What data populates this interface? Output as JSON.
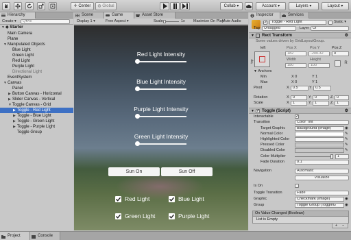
{
  "toolbar": {
    "pivot": "Center",
    "space": "Global",
    "collab": "Collab ▾",
    "account": "Account",
    "layers": "Layers",
    "layout": "Layout"
  },
  "hierarchy": {
    "tab": "Hierarchy",
    "create": "Create ▾",
    "search_placeholder": "Q▾All",
    "scene": "Starter",
    "items": [
      {
        "label": "Main Camera",
        "depth": 1,
        "tri": "",
        "state": ""
      },
      {
        "label": "Plane",
        "depth": 1,
        "tri": "",
        "state": ""
      },
      {
        "label": "Manipulated Objects",
        "depth": 1,
        "tri": "▼",
        "state": ""
      },
      {
        "label": "Blue Light",
        "depth": 2,
        "tri": "",
        "state": ""
      },
      {
        "label": "Green Light",
        "depth": 2,
        "tri": "",
        "state": ""
      },
      {
        "label": "Red Light",
        "depth": 2,
        "tri": "",
        "state": ""
      },
      {
        "label": "Purple Light",
        "depth": 2,
        "tri": "",
        "state": ""
      },
      {
        "label": "Directional Light",
        "depth": 2,
        "tri": "",
        "state": "dim"
      },
      {
        "label": "EventSystem",
        "depth": 1,
        "tri": "",
        "state": ""
      },
      {
        "label": "Canvas",
        "depth": 1,
        "tri": "▼",
        "state": ""
      },
      {
        "label": "Panel",
        "depth": 2,
        "tri": "",
        "state": ""
      },
      {
        "label": "Button Canvas - Horizontal",
        "depth": 2,
        "tri": "▶",
        "state": ""
      },
      {
        "label": "Slider Canvas - Vertical",
        "depth": 2,
        "tri": "▶",
        "state": ""
      },
      {
        "label": "Toggle Canvas - Grid",
        "depth": 2,
        "tri": "▼",
        "state": ""
      },
      {
        "label": "Toggle - Red Light",
        "depth": 3,
        "tri": "▶",
        "state": "sel"
      },
      {
        "label": "Toggle - Blue Light",
        "depth": 3,
        "tri": "▶",
        "state": ""
      },
      {
        "label": "Toggle - Green Light",
        "depth": 3,
        "tri": "▶",
        "state": ""
      },
      {
        "label": "Toggle - Purple Light",
        "depth": 3,
        "tri": "▶",
        "state": ""
      },
      {
        "label": "Toggle Group",
        "depth": 3,
        "tri": "",
        "state": ""
      }
    ]
  },
  "tabs": {
    "scene": "Scene",
    "game": "Game",
    "asset_store": "Asset Store"
  },
  "game_bar": {
    "display": "Display 1",
    "aspect": "Free Aspect",
    "scale_label": "Scale",
    "scale_value": "1x",
    "maximize": "Maximize On Play",
    "mute": "Mute Audio",
    "stats": "Stats",
    "gizmos": "Gizmos ▾"
  },
  "game": {
    "sliders": [
      {
        "label": "Red Light Intensity",
        "value": 0.0
      },
      {
        "label": "Blue Light Intensity",
        "value": 0.0
      },
      {
        "label": "Purple Light Intensity",
        "value": 0.0
      },
      {
        "label": "Green Light Intensity",
        "value": 0.0
      }
    ],
    "sun_on": "Sun On",
    "sun_off": "Sun Off",
    "toggles": [
      {
        "label": "Red Light",
        "checked": true
      },
      {
        "label": "Blue Light",
        "checked": true
      },
      {
        "label": "Green Light",
        "checked": true
      },
      {
        "label": "Purple Light",
        "checked": true
      }
    ]
  },
  "inspector": {
    "tab": "Inspector",
    "services_tab": "Services",
    "object_name": "Toggle - Red Light",
    "static": "Static ▾",
    "tag_label": "Tag",
    "tag": "Untagged",
    "layer_label": "Layer",
    "layer": "UI",
    "rect_transform": {
      "title": "Rect Transform",
      "note": "Some values driven by GridLayoutGroup.",
      "anchor": "left",
      "anchor_side": "top",
      "pos_x_label": "Pos X",
      "pos_y_label": "Pos Y",
      "pos_z_label": "Pos Z",
      "pos_x": "182",
      "pos_y": "-200.32",
      "pos_z": "0",
      "width_label": "Width",
      "height_label": "Height",
      "width": "180",
      "height": "100",
      "anchors_label": "Anchors",
      "min_label": "Min",
      "max_label": "Max",
      "min_x": "0",
      "min_y": "1",
      "max_x": "0",
      "max_y": "1",
      "pivot_label": "Pivot",
      "pivot_x": "0.5",
      "pivot_y": "0.5",
      "rotation_label": "Rotation",
      "rot_x": "0",
      "rot_y": "0",
      "rot_z": "0",
      "scale_label": "Scale",
      "scale_x": "1",
      "scale_y": "1",
      "scale_z": "1"
    },
    "toggle": {
      "title": "Toggle (Script)",
      "interactable_label": "Interactable",
      "transition_label": "Transition",
      "transition": "Color Tint",
      "target_graphic_label": "Target Graphic",
      "target_graphic": "Background (Image)",
      "normal_color_label": "Normal Color",
      "highlighted_color_label": "Highlighted Color",
      "pressed_color_label": "Pressed Color",
      "disabled_color_label": "Disabled Color",
      "color_multiplier_label": "Color Multiplier",
      "color_multiplier": "1",
      "fade_duration_label": "Fade Duration",
      "fade_duration": "0.1",
      "navigation_label": "Navigation",
      "navigation": "Automatic",
      "visualize": "Visualize",
      "is_on_label": "Is On",
      "toggle_transition_label": "Toggle Transition",
      "toggle_transition": "Fade",
      "graphic_label": "Graphic",
      "graphic": "Checkmark (Image)",
      "group_label": "Group",
      "group": "Toggle Group (ToggleG",
      "on_value_changed": "On Value Changed (Boolean)",
      "list_empty": "List is Empty"
    }
  },
  "bottom": {
    "project": "Project",
    "console": "Console"
  },
  "colors": {
    "selection": "#3d70c4",
    "panel": "#c8c8c8",
    "play_bg": "#dcdcdc"
  }
}
